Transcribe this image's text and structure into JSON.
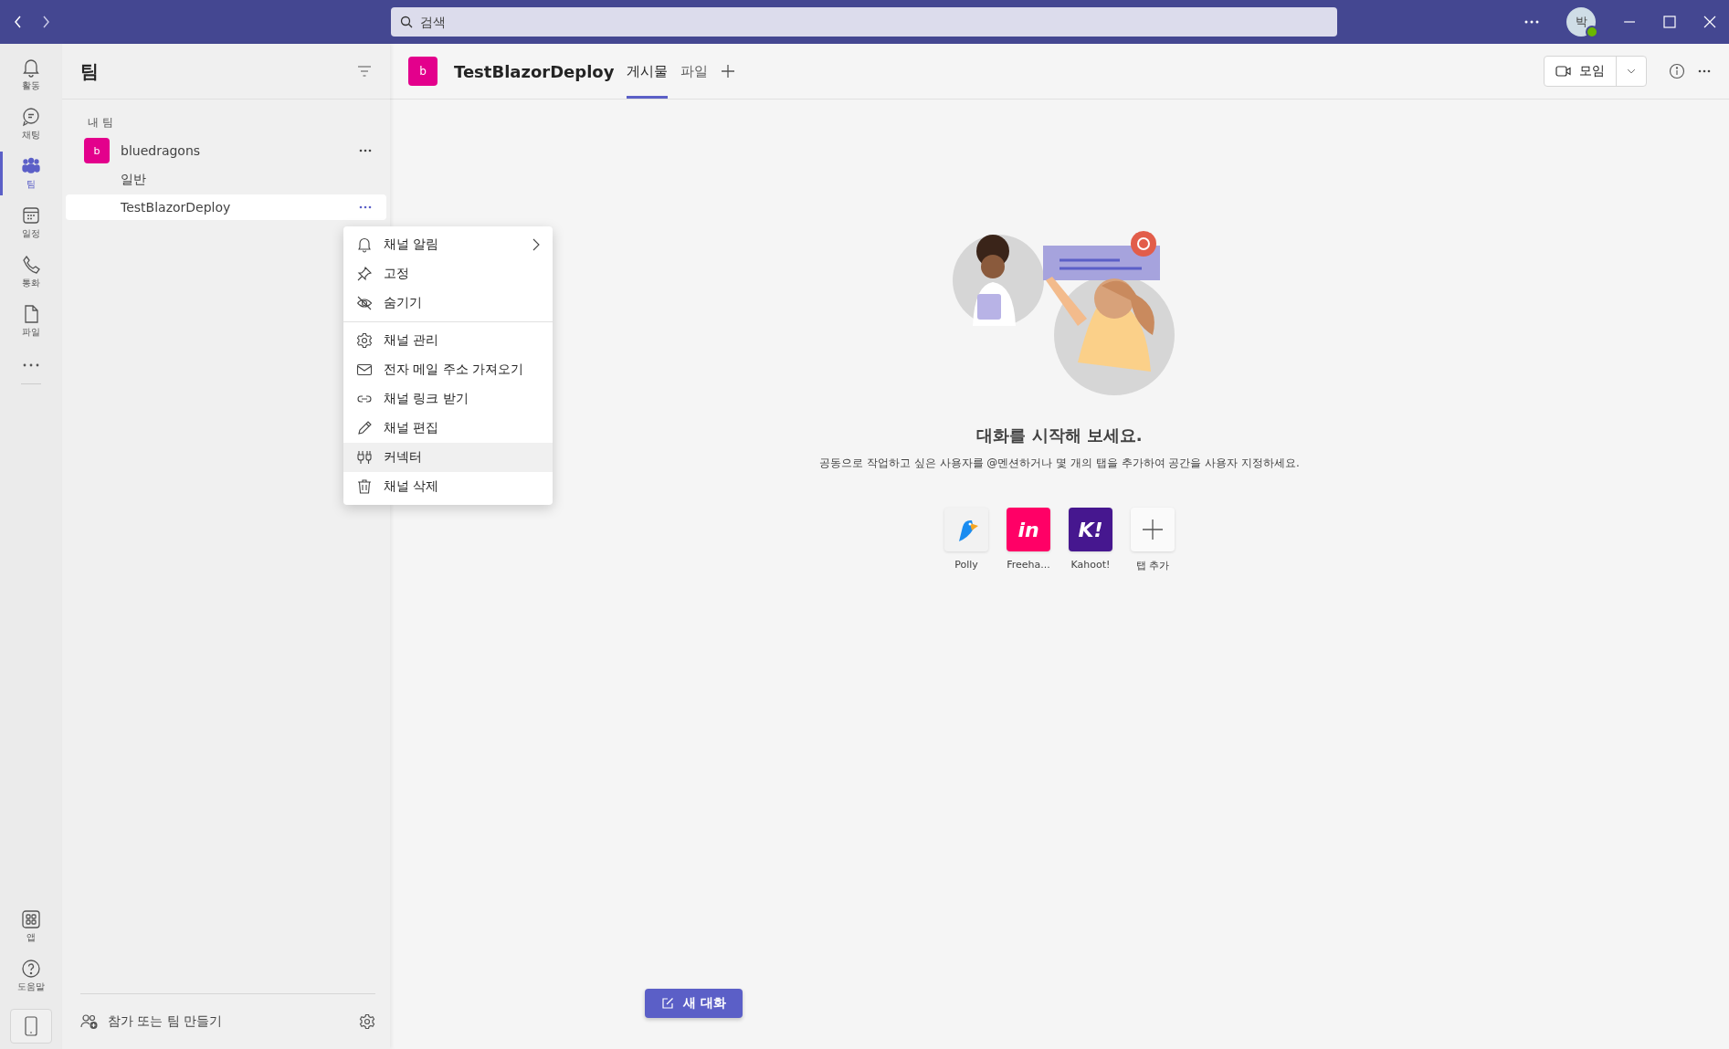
{
  "title_bar": {
    "search_placeholder": "검색",
    "avatar_initial": "박",
    "online": true
  },
  "rail": {
    "items": [
      {
        "label": "활동",
        "selected": false
      },
      {
        "label": "채팅",
        "selected": false
      },
      {
        "label": "팀",
        "selected": true
      },
      {
        "label": "일정",
        "selected": false
      },
      {
        "label": "통화",
        "selected": false
      },
      {
        "label": "파일",
        "selected": false
      }
    ],
    "bottom_items": [
      {
        "label": "앱"
      },
      {
        "label": "도움말"
      }
    ]
  },
  "sidebar": {
    "title": "팀",
    "section": "내 팀",
    "team": {
      "avatar": "b",
      "name": "bluedragons",
      "channels": [
        {
          "name": "일반",
          "selected": false
        },
        {
          "name": "TestBlazorDeploy",
          "selected": true
        }
      ]
    },
    "footer": "참가 또는 팀 만들기"
  },
  "context_menu": {
    "groups": [
      [
        {
          "label": "채널 알림",
          "submenu": true,
          "highlighted": false
        },
        {
          "label": "고정",
          "submenu": false,
          "highlighted": false
        },
        {
          "label": "숨기기",
          "submenu": false,
          "highlighted": false
        }
      ],
      [
        {
          "label": "채널 관리",
          "submenu": false,
          "highlighted": false
        },
        {
          "label": "전자 메일 주소 가져오기",
          "submenu": false,
          "highlighted": false
        },
        {
          "label": "채널 링크 받기",
          "submenu": false,
          "highlighted": false
        },
        {
          "label": "채널 편집",
          "submenu": false,
          "highlighted": false
        },
        {
          "label": "커넥터",
          "submenu": false,
          "highlighted": true
        },
        {
          "label": "채널 삭제",
          "submenu": false,
          "highlighted": false
        }
      ]
    ]
  },
  "channel_header": {
    "avatar": "b",
    "name": "TestBlazorDeploy",
    "tabs": [
      {
        "label": "게시물",
        "selected": true
      },
      {
        "label": "파일",
        "selected": false
      }
    ],
    "meet_button": "모임"
  },
  "empty_state": {
    "title": "대화를 시작해 보세요.",
    "text": "공동으로 작업하고 싶은 사용자를 @멘션하거나 몇 개의 탭을 추가하여 공간을 사용자 지정하세요.",
    "apps": [
      {
        "name": "Polly",
        "kind": "bird",
        "color": "#f2f2f2"
      },
      {
        "name": "Freeha...",
        "kind": "text",
        "logo_text": "in",
        "color": "#ff0066"
      },
      {
        "name": "Kahoot!",
        "kind": "text",
        "logo_text": "K!",
        "color": "#46178f"
      },
      {
        "name": "탭 추가",
        "kind": "add",
        "color": "#fafafa"
      }
    ]
  },
  "new_chat_button": "새 대화"
}
